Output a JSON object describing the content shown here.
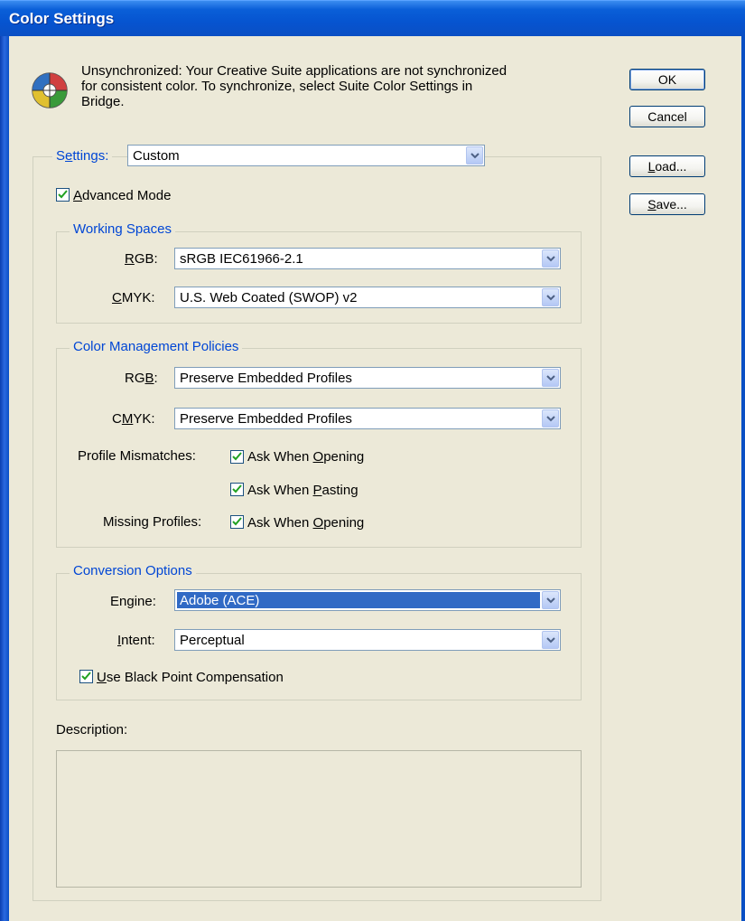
{
  "window": {
    "title": "Color Settings"
  },
  "message": "Unsynchronized: Your Creative Suite applications are not synchronized for consistent color. To synchronize, select Suite Color Settings in Bridge.",
  "buttons": {
    "ok": "OK",
    "cancel": "Cancel",
    "load_pre": "",
    "load_u": "L",
    "load_post": "oad...",
    "save_pre": "",
    "save_u": "S",
    "save_post": "ave..."
  },
  "settings": {
    "label_pre": "S",
    "label_u": "e",
    "label_post": "ttings:",
    "value": "Custom"
  },
  "advanced_mode": {
    "checked": true,
    "label_u": "A",
    "label_post": "dvanced Mode"
  },
  "working_spaces": {
    "legend": "Working Spaces",
    "rgb": {
      "label_u": "R",
      "label_post": "GB:",
      "value": "sRGB IEC61966-2.1"
    },
    "cmyk": {
      "label_u": "C",
      "label_post": "MYK:",
      "value": "U.S. Web Coated (SWOP) v2"
    }
  },
  "policies": {
    "legend": "Color Management Policies",
    "rgb": {
      "label_pre": "RG",
      "label_u": "B",
      "label_post": ":",
      "value": "Preserve Embedded Profiles"
    },
    "cmyk": {
      "label_pre": "C",
      "label_u": "M",
      "label_post": "YK:",
      "value": "Preserve Embedded Profiles"
    },
    "profile_mismatches_label": "Profile Mismatches:",
    "ask_opening": {
      "checked": true,
      "pre": "Ask When ",
      "u": "O",
      "post": "pening"
    },
    "ask_pasting": {
      "checked": true,
      "pre": "Ask When ",
      "u": "P",
      "post": "asting"
    },
    "missing_profiles_label": "Missing Profiles:",
    "missing_ask_opening": {
      "checked": true,
      "pre": "Ask When ",
      "u": "O",
      "post": "pening"
    }
  },
  "conversion": {
    "legend": "Conversion Options",
    "engine": {
      "label_pre": "En",
      "label_u": "g",
      "label_post": "ine:",
      "value": "Adobe (ACE)"
    },
    "intent": {
      "label_u": "I",
      "label_post": "ntent:",
      "value": "Perceptual"
    },
    "bpc": {
      "checked": true,
      "u": "U",
      "post": "se Black Point Compensation"
    }
  },
  "description": {
    "label": "Description:",
    "text": ""
  },
  "colors": {
    "title_bar": "#0654d0",
    "legend_text": "#0046d5",
    "dialog_bg": "#ECE9D8",
    "selection": "#316ac5"
  }
}
